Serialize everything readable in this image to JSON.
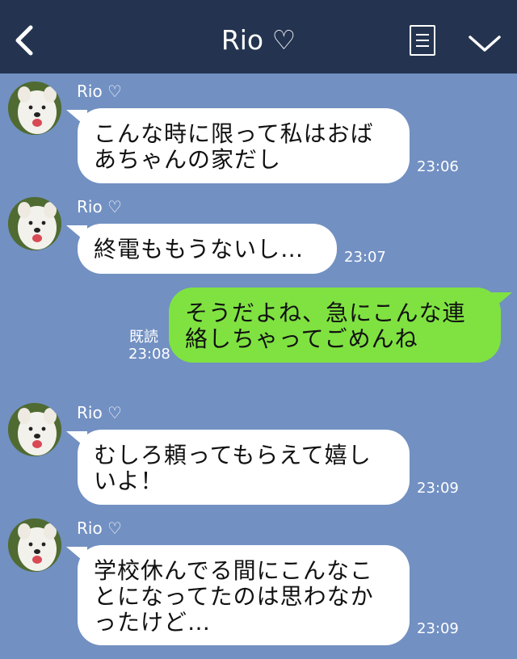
{
  "header": {
    "title": "Rio ♡",
    "back_icon": "chevron-left-icon",
    "menu_icon": "menu-lines-icon",
    "collapse_icon": "chevron-down-icon"
  },
  "colors": {
    "header_bg": "#243450",
    "chat_bg": "#7290c2",
    "incoming_bubble": "#ffffff",
    "outgoing_bubble": "#7fe241"
  },
  "messages": [
    {
      "sender": "Rio ♡",
      "text": "こんな時に限って私はおば\nあちゃんの家だし",
      "time": "23:06"
    },
    {
      "sender": "Rio ♡",
      "text": "終電ももうないし…",
      "time": "23:07"
    },
    {
      "read_label": "既読",
      "text": "そうだよね、急にこんな連\n絡しちゃってごめんね",
      "time": "23:08"
    },
    {
      "sender": "Rio ♡",
      "text": "むしろ頼ってもらえて嬉し\nいよ！",
      "time": "23:09"
    },
    {
      "sender": "Rio ♡",
      "text": "学校休んでる間にこんなこ\nとになってたのは思わなか\nったけど…",
      "time": "23:09"
    }
  ]
}
